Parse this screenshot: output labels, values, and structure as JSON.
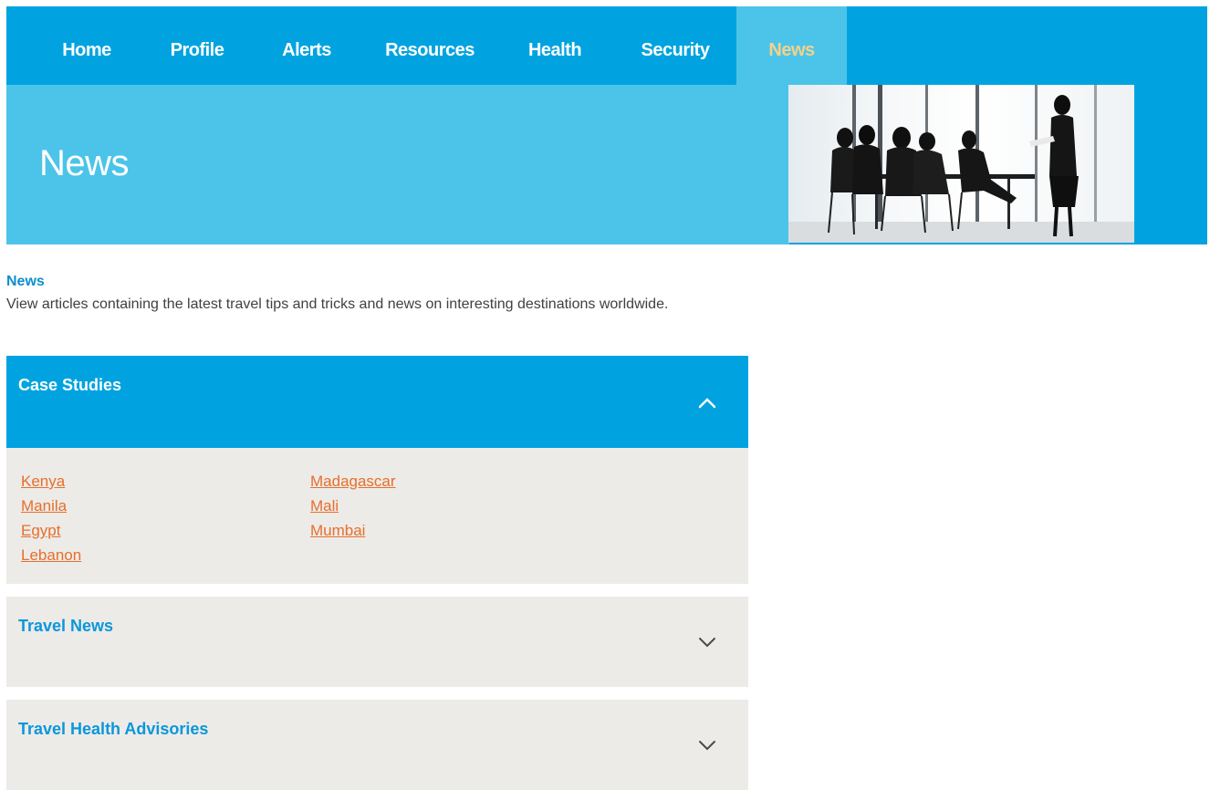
{
  "nav": {
    "items": [
      {
        "label": "Home"
      },
      {
        "label": "Profile"
      },
      {
        "label": "Alerts"
      },
      {
        "label": "Resources"
      },
      {
        "label": "Health"
      },
      {
        "label": "Security"
      },
      {
        "label": "News",
        "active": true
      }
    ]
  },
  "hero": {
    "title": "News",
    "image": "business-meeting-silhouette-photo"
  },
  "intro": {
    "title": "News",
    "text": "View articles containing the latest travel tips and tricks and news on interesting destinations worldwide."
  },
  "accordion": {
    "case_studies": {
      "title": "Case Studies",
      "state": "expanded",
      "icon": "chevron-up-icon",
      "links_col1": [
        "Kenya",
        "Manila",
        "Egypt",
        "Lebanon"
      ],
      "links_col2": [
        "Madagascar",
        "Mali",
        "Mumbai"
      ]
    },
    "travel_news": {
      "title": "Travel News",
      "state": "collapsed",
      "icon": "chevron-down-icon"
    },
    "travel_health": {
      "title": "Travel Health Advisories",
      "state": "collapsed",
      "icon": "chevron-down-icon"
    }
  },
  "colors": {
    "nav_blue": "#00a3e0",
    "hero_light_blue": "#4cc4e9",
    "active_nav_text": "#f3d28a",
    "panel_gray": "#edebe8",
    "link_orange": "#e66f2b",
    "heading_blue": "#0a97db",
    "body_text": "#3f4044"
  }
}
